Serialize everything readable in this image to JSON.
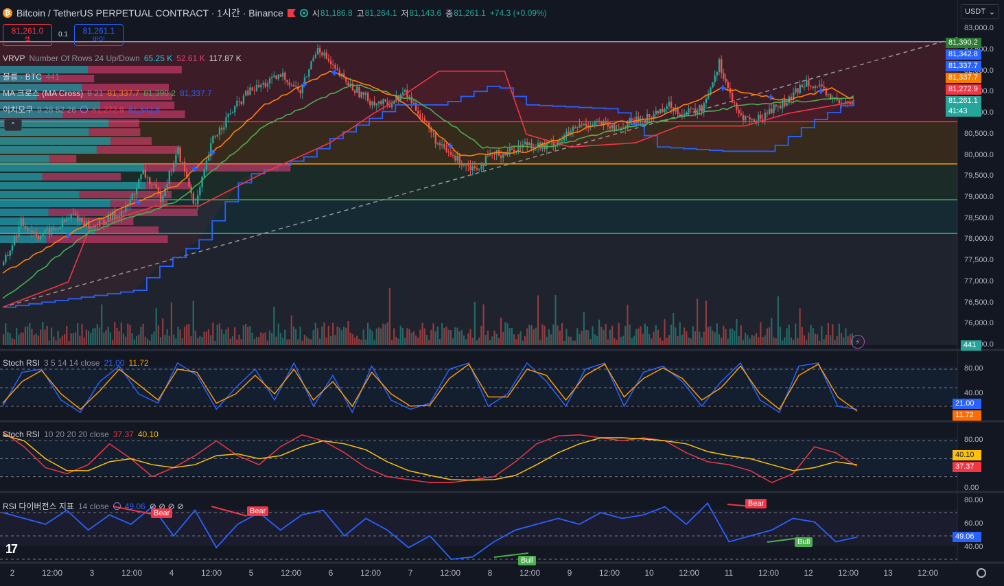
{
  "header": {
    "coin_icon_glyph": "₿",
    "title": "Bitcoin / TetherUS PERPETUAL CONTRACT · 1시간 · Binance",
    "open_label": "시",
    "open": "81,186.8",
    "high_label": "고",
    "high": "81,264.1",
    "low_label": "저",
    "low": "81,143.6",
    "close_label": "종",
    "close": "81,261.1",
    "change": "+74.3 (+0.09%)"
  },
  "trade": {
    "sell_price": "81,261.0",
    "sell_label": "셀",
    "spread": "0.1",
    "buy_price": "81,261.1",
    "buy_label": "바이"
  },
  "currency": {
    "label": "USDT",
    "chevron": "⌄"
  },
  "indicators": {
    "vrvp": {
      "name": "VRVP",
      "params": "Number Of Rows 24 Up/Down",
      "up": "65.25 K",
      "down": "52.61 K",
      "total": "117.87 K"
    },
    "volume": {
      "name": "볼륨 · BTC",
      "value": "441"
    },
    "ma_cross": {
      "name": "MA 크로스 (MA Cross)",
      "params": "9 21",
      "v1": "81,337.7",
      "v2": "81,390.2",
      "v3": "81,337.7"
    },
    "ichimoku": {
      "name": "이치모쿠",
      "params": "9 26 52 26",
      "v1": "81,272.9",
      "v2": "81,342.8"
    },
    "stoch1": {
      "name": "Stoch RSI",
      "params": "3 5 14 14 close",
      "k": "21.00",
      "d": "11.72"
    },
    "stoch2": {
      "name": "Stoch RSI",
      "params": "10 20 20 20 close",
      "k": "37.37",
      "d": "40.10"
    },
    "rsi_div": {
      "name": "RSI 다이버전스 지표",
      "params": "14 close",
      "value": "49.06",
      "circles": "⊘ ⊘ ⊘ ⊘"
    }
  },
  "collapse_glyph": "⌃",
  "logo_text": "17",
  "price_axis": {
    "ticks": [
      "83,000.0",
      "82,500.0",
      "82,000.0",
      "81,500.0",
      "81,000.0",
      "80,500.0",
      "80,000.0",
      "79,500.0",
      "79,000.0",
      "78,500.0",
      "78,000.0",
      "77,500.0",
      "77,000.0",
      "76,500.0",
      "76,000.0",
      "75,500.0"
    ],
    "labels": [
      {
        "text": "81,390.2",
        "color": "#2e7d32"
      },
      {
        "text": "81,342.8",
        "color": "#2962ff"
      },
      {
        "text": "81,337.7",
        "color": "#2962ff"
      },
      {
        "text": "81,337.7",
        "color": "#f57c00"
      },
      {
        "text": "81,272.9",
        "color": "#f23645"
      },
      {
        "text": "81,261.1",
        "color": "#26a69a"
      },
      {
        "text": "41:43",
        "color": "#26a69a"
      }
    ],
    "volume_label": "441"
  },
  "stoch1_axis": {
    "ticks": [
      "80.00",
      "40.00"
    ],
    "k_label": "21.00",
    "d_label": "11.72"
  },
  "stoch2_axis": {
    "ticks": [
      "80.00",
      "0.00"
    ],
    "d_label": "40.10",
    "k_label": "37.37"
  },
  "rsi_axis": {
    "ticks": [
      "80.00",
      "60.00",
      "40.00"
    ],
    "label": "49.06"
  },
  "time_axis": [
    "2",
    "12:00",
    "3",
    "12:00",
    "4",
    "12:00",
    "5",
    "12:00",
    "6",
    "12:00",
    "7",
    "12:00",
    "8",
    "12:00",
    "9",
    "12:00",
    "10",
    "12:00",
    "11",
    "12:00",
    "12",
    "12:00",
    "13",
    "12:00"
  ],
  "divergence_tags": [
    {
      "text": "Bear",
      "type": "bear"
    },
    {
      "text": "Bear",
      "type": "bear"
    },
    {
      "text": "Bear",
      "type": "bear"
    },
    {
      "text": "Bull",
      "type": "bull"
    },
    {
      "text": "Bull",
      "type": "bull"
    }
  ],
  "colors": {
    "bg": "#131722",
    "up": "#26a69a",
    "down": "#ef5350",
    "ma_fast": "#ff7f0e",
    "ma_slow": "#4caf50",
    "ichimoku_conv": "#2962ff",
    "ichimoku_base": "#f23645",
    "stoch_k": "#2962ff",
    "stoch_d": "#ff9800",
    "stoch2_k": "#f23645",
    "stoch2_d": "#ffc107",
    "rsi": "#2962ff"
  },
  "chart_data": [
    {
      "type": "candlestick",
      "title": "Bitcoin / TetherUS PERPETUAL CONTRACT · 1시간 · Binance",
      "ylim": [
        75500,
        83200
      ],
      "x_ticks": [
        "2",
        "12:00",
        "3",
        "12:00",
        "4",
        "12:00",
        "5",
        "12:00",
        "6",
        "12:00",
        "7",
        "12:00",
        "8",
        "12:00",
        "9",
        "12:00",
        "10",
        "12:00",
        "11",
        "12:00",
        "12",
        "12:00",
        "13",
        "12:00"
      ],
      "horizontal_levels": [
        82700,
        80800,
        79800,
        78950,
        78150
      ],
      "close_anchor_series": [
        [
          0,
          77400
        ],
        [
          8,
          78400
        ],
        [
          16,
          78100
        ],
        [
          24,
          78250
        ],
        [
          32,
          78600
        ],
        [
          40,
          78300
        ],
        [
          48,
          78500
        ],
        [
          56,
          78700
        ],
        [
          64,
          79600
        ],
        [
          72,
          79000
        ],
        [
          80,
          80100
        ],
        [
          88,
          78800
        ],
        [
          96,
          80400
        ],
        [
          104,
          81000
        ],
        [
          112,
          81500
        ],
        [
          120,
          81700
        ],
        [
          128,
          81900
        ],
        [
          136,
          81500
        ],
        [
          144,
          82600
        ],
        [
          152,
          82000
        ],
        [
          160,
          81600
        ],
        [
          168,
          81300
        ],
        [
          176,
          81200
        ],
        [
          184,
          81500
        ],
        [
          192,
          80900
        ],
        [
          200,
          80200
        ],
        [
          208,
          79900
        ],
        [
          216,
          79700
        ],
        [
          224,
          80000
        ],
        [
          232,
          80100
        ],
        [
          240,
          80300
        ],
        [
          248,
          80200
        ],
        [
          256,
          80400
        ],
        [
          264,
          80700
        ],
        [
          272,
          80800
        ],
        [
          280,
          80600
        ],
        [
          288,
          80800
        ],
        [
          296,
          80900
        ],
        [
          304,
          81200
        ],
        [
          312,
          81000
        ],
        [
          320,
          81100
        ],
        [
          328,
          82200
        ],
        [
          336,
          81000
        ],
        [
          344,
          80800
        ],
        [
          352,
          81100
        ],
        [
          360,
          81300
        ],
        [
          368,
          81800
        ],
        [
          376,
          81500
        ],
        [
          384,
          81200
        ],
        [
          390,
          81261
        ]
      ],
      "ma_fast_anchor": [
        [
          0,
          77200
        ],
        [
          40,
          78400
        ],
        [
          80,
          79300
        ],
        [
          120,
          81200
        ],
        [
          150,
          82000
        ],
        [
          180,
          81400
        ],
        [
          210,
          80000
        ],
        [
          240,
          80100
        ],
        [
          270,
          80700
        ],
        [
          300,
          80900
        ],
        [
          330,
          81600
        ],
        [
          360,
          81300
        ],
        [
          380,
          81600
        ],
        [
          390,
          81337
        ]
      ],
      "ma_slow_anchor": [
        [
          0,
          76600
        ],
        [
          40,
          78200
        ],
        [
          80,
          78900
        ],
        [
          120,
          80700
        ],
        [
          160,
          81700
        ],
        [
          190,
          81300
        ],
        [
          220,
          80200
        ],
        [
          250,
          80200
        ],
        [
          280,
          80600
        ],
        [
          310,
          80900
        ],
        [
          340,
          81200
        ],
        [
          370,
          81300
        ],
        [
          390,
          81390
        ]
      ],
      "ichimoku_conv_anchor": [
        [
          0,
          76400
        ],
        [
          60,
          76800
        ],
        [
          70,
          77300
        ],
        [
          90,
          78000
        ],
        [
          110,
          79500
        ],
        [
          140,
          80000
        ],
        [
          150,
          80400
        ],
        [
          180,
          81200
        ],
        [
          200,
          81200
        ],
        [
          215,
          81500
        ],
        [
          225,
          81700
        ],
        [
          240,
          81200
        ],
        [
          280,
          81100
        ],
        [
          300,
          80200
        ],
        [
          330,
          80100
        ],
        [
          350,
          80100
        ],
        [
          370,
          80800
        ],
        [
          390,
          81342
        ]
      ],
      "ichimoku_base_anchor": [
        [
          0,
          76400
        ],
        [
          30,
          77000
        ],
        [
          40,
          78300
        ],
        [
          70,
          78800
        ],
        [
          90,
          78800
        ],
        [
          120,
          79600
        ],
        [
          150,
          80300
        ],
        [
          170,
          81000
        ],
        [
          180,
          81300
        ],
        [
          200,
          82000
        ],
        [
          230,
          82000
        ],
        [
          240,
          80500
        ],
        [
          260,
          80200
        ],
        [
          290,
          80300
        ],
        [
          310,
          80700
        ],
        [
          340,
          80700
        ],
        [
          360,
          81000
        ],
        [
          390,
          81272
        ]
      ],
      "trendline": [
        [
          0,
          76400
        ],
        [
          390,
          82800
        ]
      ]
    },
    {
      "type": "line",
      "title": "Stoch RSI 3 5 14 14 close",
      "ylim": [
        0,
        100
      ],
      "series": [
        {
          "name": "K",
          "values": [
            20,
            75,
            80,
            30,
            10,
            60,
            85,
            40,
            25,
            90,
            70,
            15,
            50,
            80,
            30,
            90,
            20,
            70,
            10,
            85,
            30,
            15,
            25,
            80,
            90,
            20,
            40,
            90,
            60,
            20,
            80,
            90,
            20,
            75,
            85,
            60,
            20,
            60,
            90,
            30,
            10,
            85,
            90,
            20,
            15
          ]
        },
        {
          "name": "D",
          "values": [
            25,
            60,
            78,
            40,
            15,
            45,
            80,
            55,
            30,
            80,
            75,
            25,
            40,
            70,
            40,
            80,
            30,
            60,
            20,
            75,
            40,
            20,
            22,
            65,
            88,
            35,
            35,
            80,
            70,
            30,
            70,
            88,
            35,
            65,
            82,
            65,
            30,
            50,
            85,
            40,
            15,
            70,
            88,
            35,
            12
          ]
        }
      ]
    },
    {
      "type": "line",
      "title": "Stoch RSI 10 20 20 20 close",
      "ylim": [
        0,
        100
      ],
      "series": [
        {
          "name": "K",
          "values": [
            95,
            70,
            35,
            25,
            40,
            75,
            50,
            20,
            35,
            55,
            80,
            55,
            40,
            70,
            90,
            80,
            60,
            35,
            20,
            15,
            10,
            10,
            15,
            20,
            45,
            75,
            88,
            90,
            85,
            80,
            85,
            80,
            60,
            45,
            40,
            30,
            10,
            25,
            70,
            60,
            37
          ]
        },
        {
          "name": "D",
          "values": [
            90,
            80,
            50,
            30,
            30,
            45,
            50,
            40,
            35,
            40,
            55,
            58,
            50,
            55,
            70,
            80,
            75,
            65,
            45,
            30,
            22,
            15,
            14,
            15,
            22,
            40,
            60,
            75,
            85,
            85,
            83,
            80,
            75,
            62,
            55,
            50,
            40,
            30,
            35,
            45,
            40
          ]
        }
      ]
    },
    {
      "type": "line",
      "title": "RSI 다이버전스 지표 14 close",
      "ylim": [
        30,
        80
      ],
      "series": [
        {
          "name": "RSI",
          "values": [
            70,
            65,
            60,
            72,
            55,
            68,
            60,
            75,
            50,
            72,
            40,
            60,
            70,
            55,
            68,
            72,
            50,
            65,
            55,
            40,
            50,
            30,
            32,
            45,
            55,
            60,
            65,
            60,
            70,
            65,
            68,
            75,
            60,
            78,
            45,
            50,
            55,
            65,
            62,
            45,
            49
          ]
        }
      ]
    }
  ]
}
